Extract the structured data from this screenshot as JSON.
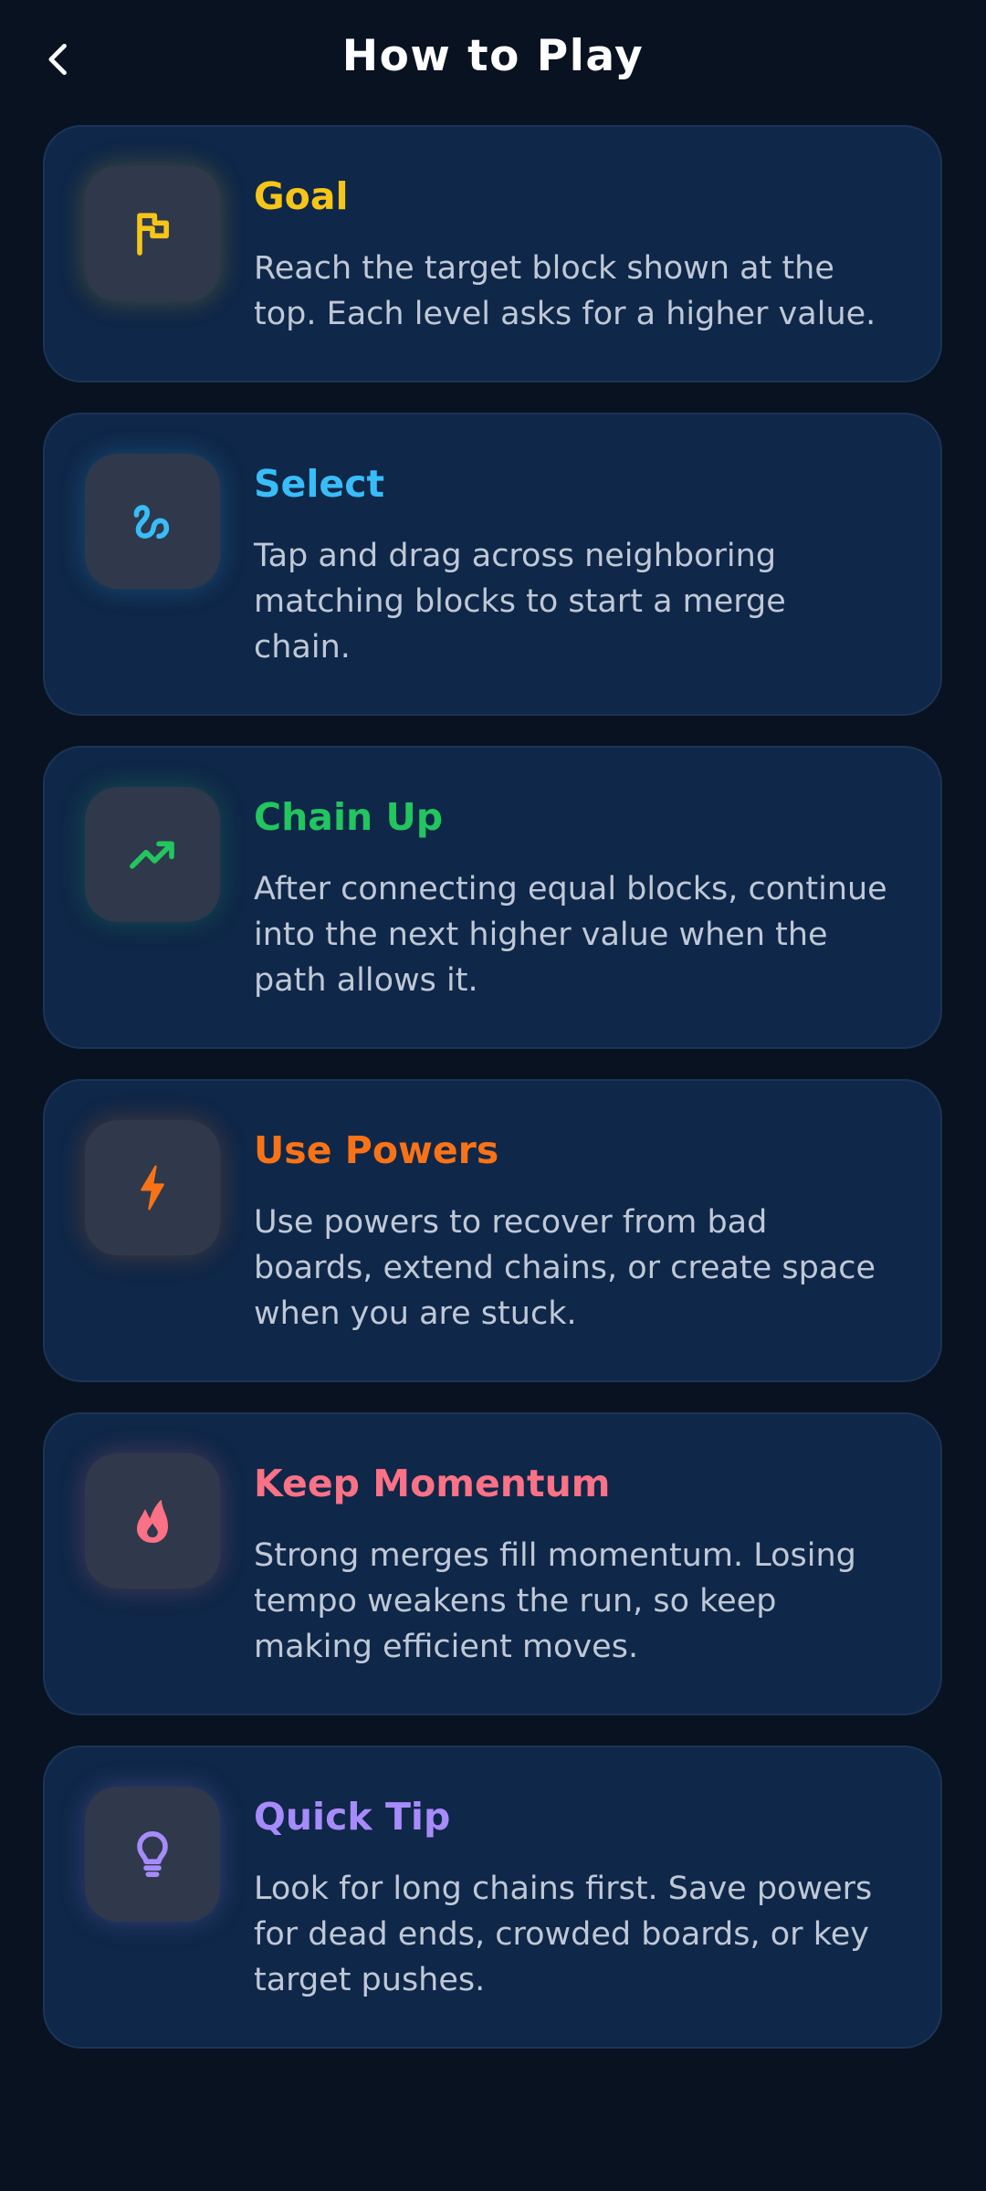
{
  "header": {
    "title": "How to Play",
    "back_icon": "chevron-left-icon"
  },
  "colors": {
    "background": "#091221",
    "card_background": "#0f2748",
    "icon_box": "#2f394b",
    "body_text": "#bfc8d6"
  },
  "cards": [
    {
      "title": "Goal",
      "text": "Reach the target block shown at the top. Each level asks for a higher value.",
      "icon": "flag-icon",
      "color": "#f5c518"
    },
    {
      "title": "Select",
      "text": "Tap and drag across neighboring matching blocks to start a merge chain.",
      "icon": "squiggle-path-icon",
      "color": "#38bdf8"
    },
    {
      "title": "Chain Up",
      "text": "After connecting equal blocks, continue into the next higher value when the path allows it.",
      "icon": "trending-up-icon",
      "color": "#22c55e"
    },
    {
      "title": "Use Powers",
      "text": "Use powers to recover from bad boards, extend chains, or create space when you are stuck.",
      "icon": "lightning-bolt-icon",
      "color": "#f97316"
    },
    {
      "title": "Keep Momentum",
      "text": "Strong merges fill momentum. Losing tempo weakens the run, so keep making efficient moves.",
      "icon": "flame-icon",
      "color": "#fb7185"
    },
    {
      "title": "Quick Tip",
      "text": "Look for long chains first. Save powers for dead ends, crowded boards, or key target pushes.",
      "icon": "lightbulb-icon",
      "color": "#a78bfa"
    }
  ]
}
